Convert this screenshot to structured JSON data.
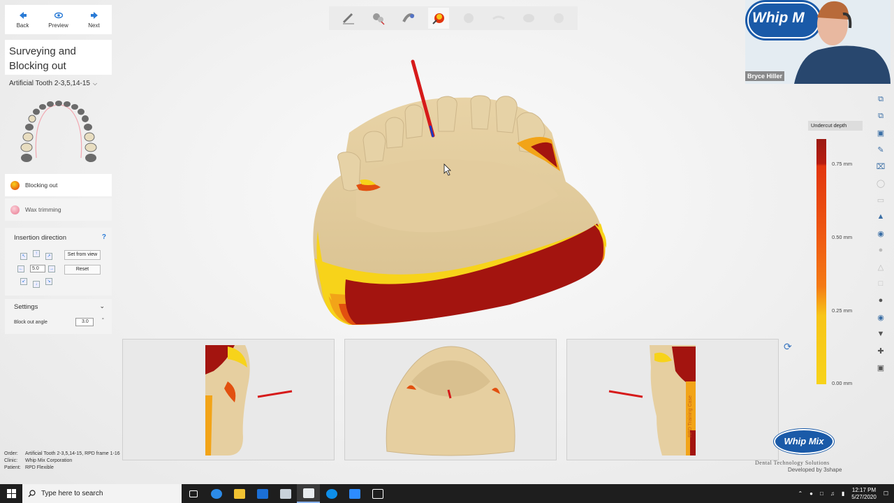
{
  "nav": {
    "back": "Back",
    "preview": "Preview",
    "next": "Next"
  },
  "step": {
    "title_line1": "Surveying and",
    "title_line2": "Blocking out",
    "selector": "Artificial Tooth 2-3,5,14-15"
  },
  "modes": [
    {
      "label": "Blocking out",
      "color": "#e8a11a"
    },
    {
      "label": "Wax trimming",
      "color": "#ef8aa0"
    }
  ],
  "insertion": {
    "title": "Insertion direction",
    "help": "?",
    "step_value": "5.0",
    "set_from_view": "Set from view",
    "reset": "Reset"
  },
  "settings": {
    "title": "Settings",
    "block_out_angle_label": "Block out angle",
    "block_out_angle": "3.0",
    "unit": "°"
  },
  "webcam": {
    "name": "Bryce Hiller",
    "logo": "Whip M"
  },
  "legend": {
    "title": "Undercut depth",
    "ticks": [
      "0.75 mm",
      "0.50 mm",
      "0.25 mm",
      "0.00 mm"
    ]
  },
  "info": {
    "order_key": "Order:",
    "order": "Artificial Tooth 2-3,5,14-15, RPD frame 1-16",
    "clinic_key": "Clinic:",
    "clinic": "Whip Mix Corporation",
    "patient_key": "Patient:",
    "patient": "RPD Flexible"
  },
  "brand": {
    "logo": "Whip Mix",
    "tagline": "Dental Technology Solutions",
    "developed": "Developed by 3shape"
  },
  "side_label": "RPD Training Case",
  "taskbar": {
    "search": "Type here to search",
    "time": "12:17 PM",
    "date": "5/27/2020"
  },
  "colors": {
    "accent": "#2a7bd6",
    "undercut_red": "#a3140f",
    "undercut_orange": "#ef5a12",
    "undercut_yellow": "#f7d31a",
    "model": "#e6cfa0"
  }
}
